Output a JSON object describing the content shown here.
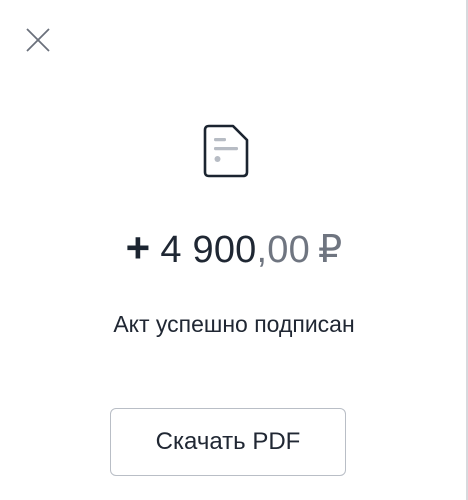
{
  "close_button": {
    "icon": "close-icon"
  },
  "document_icon": {
    "icon": "document-icon",
    "color": "#1b2430"
  },
  "amount": {
    "sign": "+",
    "integer": "4 900",
    "fraction": ",00",
    "currency": "₽"
  },
  "status_text": "Акт успешно подписан",
  "download_button": {
    "label": "Скачать PDF"
  },
  "colors": {
    "text_primary": "#1f2733",
    "text_secondary": "#6f7580",
    "border": "#b9bec6"
  }
}
